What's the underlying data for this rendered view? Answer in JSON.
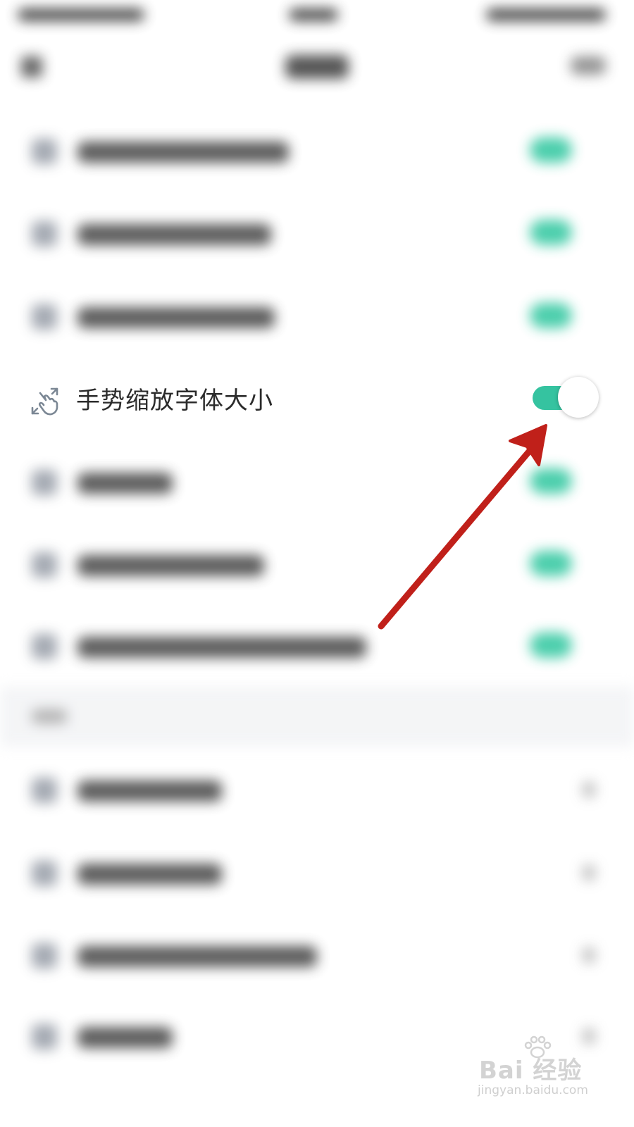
{
  "focus_setting": {
    "label": "手势缩放字体大小",
    "icon": "gesture-zoom-icon",
    "enabled": true
  },
  "colors": {
    "toggle_on": "#35c3a0",
    "arrow": "#c0201a",
    "label_text": "#2b2b2b"
  },
  "watermark": {
    "brand": "Bai  经验",
    "url": "jingyan.baidu.com"
  }
}
